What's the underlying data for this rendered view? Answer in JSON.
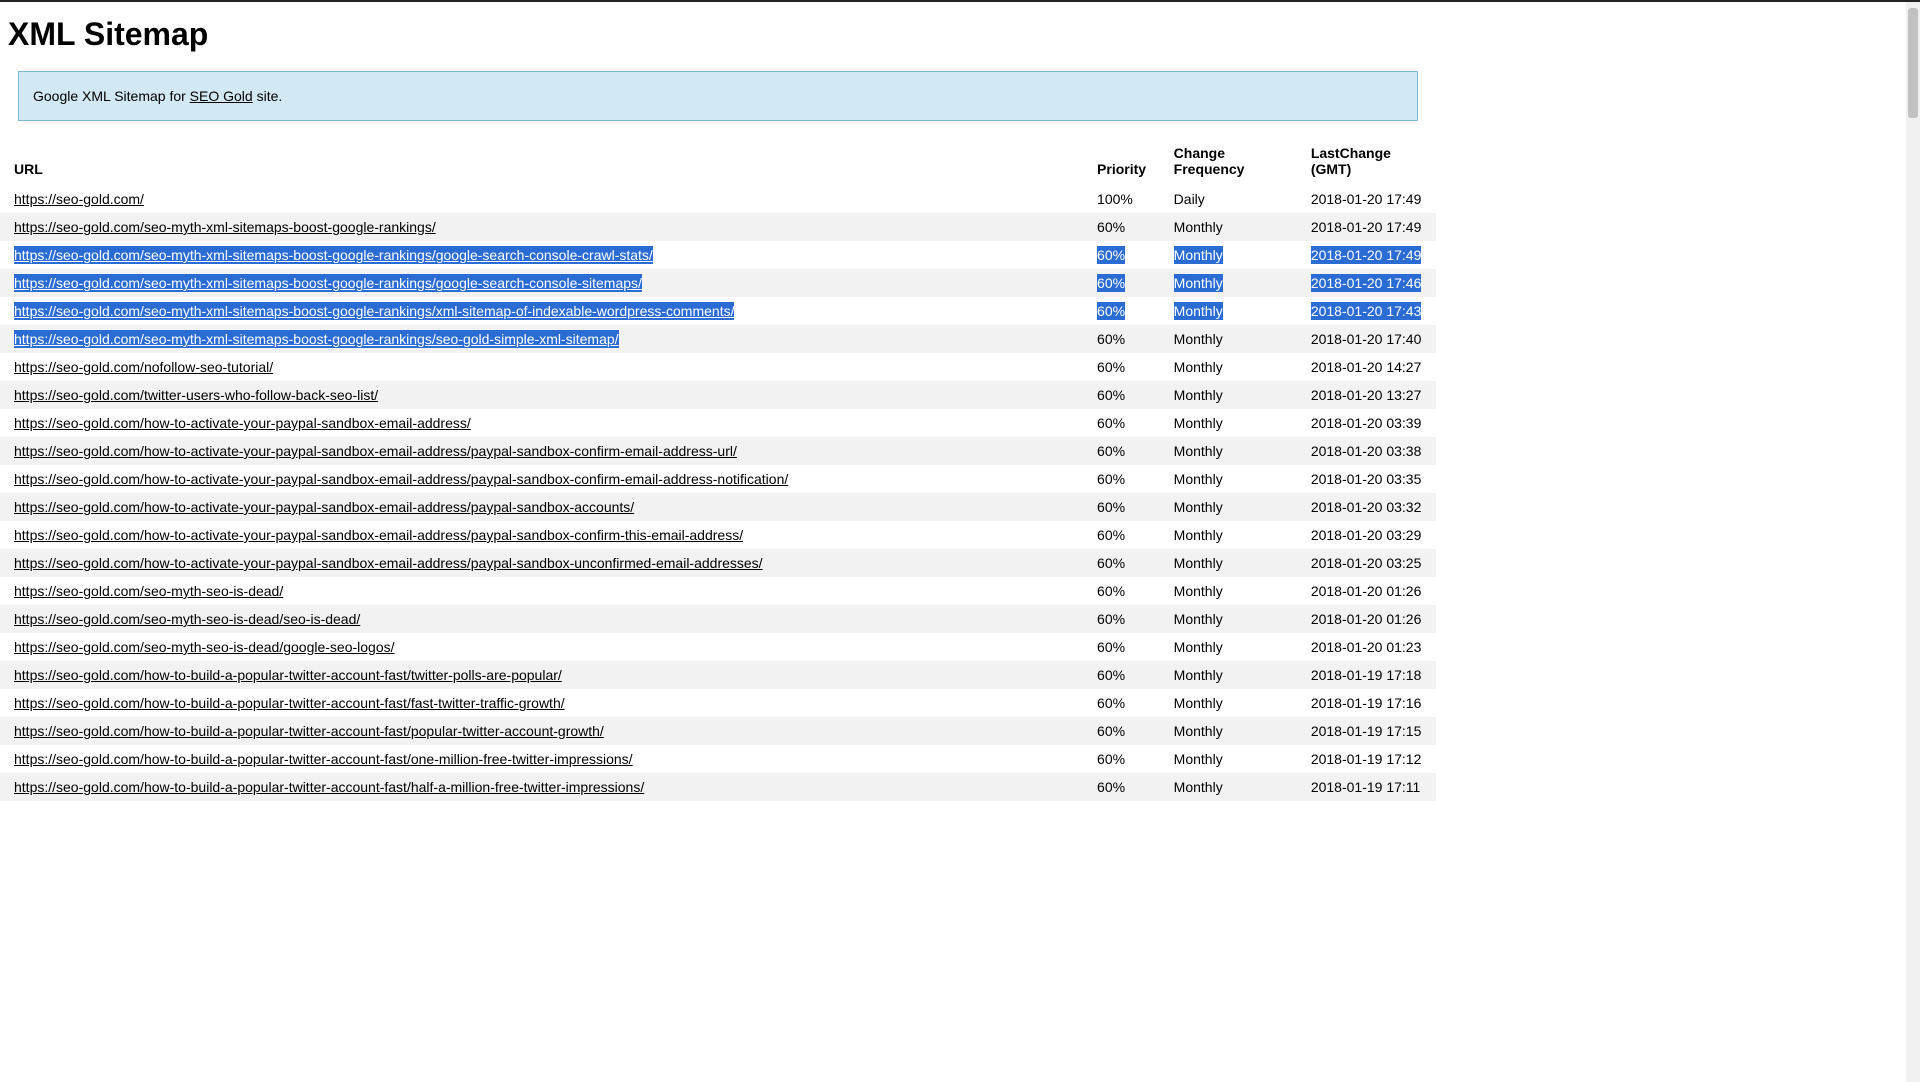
{
  "page": {
    "title": "XML Sitemap",
    "info_prefix": "Google XML Sitemap for ",
    "info_link_text": "SEO Gold",
    "info_suffix": " site."
  },
  "table": {
    "headers": {
      "url": "URL",
      "priority": "Priority",
      "changefreq_line1": "Change",
      "changefreq_line2": "Frequency",
      "lastchange_line1": "LastChange",
      "lastchange_line2": "(GMT)"
    },
    "rows": [
      {
        "url": "https://seo-gold.com/",
        "priority": "100%",
        "changefreq": "Daily",
        "lastchange": "2018-01-20 17:49",
        "selected_cols": []
      },
      {
        "url": "https://seo-gold.com/seo-myth-xml-sitemaps-boost-google-rankings/",
        "priority": "60%",
        "changefreq": "Monthly",
        "lastchange": "2018-01-20 17:49",
        "selected_cols": []
      },
      {
        "url": "https://seo-gold.com/seo-myth-xml-sitemaps-boost-google-rankings/google-search-console-crawl-stats/",
        "priority": "60%",
        "changefreq": "Monthly",
        "lastchange": "2018-01-20 17:49",
        "selected_cols": [
          "url",
          "priority",
          "changefreq",
          "lastchange"
        ]
      },
      {
        "url": "https://seo-gold.com/seo-myth-xml-sitemaps-boost-google-rankings/google-search-console-sitemaps/",
        "priority": "60%",
        "changefreq": "Monthly",
        "lastchange": "2018-01-20 17:46",
        "selected_cols": [
          "url",
          "priority",
          "changefreq",
          "lastchange"
        ]
      },
      {
        "url": "https://seo-gold.com/seo-myth-xml-sitemaps-boost-google-rankings/xml-sitemap-of-indexable-wordpress-comments/",
        "priority": "60%",
        "changefreq": "Monthly",
        "lastchange": "2018-01-20 17:43",
        "selected_cols": [
          "url",
          "priority",
          "changefreq",
          "lastchange"
        ]
      },
      {
        "url": "https://seo-gold.com/seo-myth-xml-sitemaps-boost-google-rankings/seo-gold-simple-xml-sitemap/",
        "priority": "60%",
        "changefreq": "Monthly",
        "lastchange": "2018-01-20 17:40",
        "selected_cols": [
          "url"
        ]
      },
      {
        "url": "https://seo-gold.com/nofollow-seo-tutorial/",
        "priority": "60%",
        "changefreq": "Monthly",
        "lastchange": "2018-01-20 14:27",
        "selected_cols": []
      },
      {
        "url": "https://seo-gold.com/twitter-users-who-follow-back-seo-list/",
        "priority": "60%",
        "changefreq": "Monthly",
        "lastchange": "2018-01-20 13:27",
        "selected_cols": []
      },
      {
        "url": "https://seo-gold.com/how-to-activate-your-paypal-sandbox-email-address/",
        "priority": "60%",
        "changefreq": "Monthly",
        "lastchange": "2018-01-20 03:39",
        "selected_cols": []
      },
      {
        "url": "https://seo-gold.com/how-to-activate-your-paypal-sandbox-email-address/paypal-sandbox-confirm-email-address-url/",
        "priority": "60%",
        "changefreq": "Monthly",
        "lastchange": "2018-01-20 03:38",
        "selected_cols": []
      },
      {
        "url": "https://seo-gold.com/how-to-activate-your-paypal-sandbox-email-address/paypal-sandbox-confirm-email-address-notification/",
        "priority": "60%",
        "changefreq": "Monthly",
        "lastchange": "2018-01-20 03:35",
        "selected_cols": []
      },
      {
        "url": "https://seo-gold.com/how-to-activate-your-paypal-sandbox-email-address/paypal-sandbox-accounts/",
        "priority": "60%",
        "changefreq": "Monthly",
        "lastchange": "2018-01-20 03:32",
        "selected_cols": []
      },
      {
        "url": "https://seo-gold.com/how-to-activate-your-paypal-sandbox-email-address/paypal-sandbox-confirm-this-email-address/",
        "priority": "60%",
        "changefreq": "Monthly",
        "lastchange": "2018-01-20 03:29",
        "selected_cols": []
      },
      {
        "url": "https://seo-gold.com/how-to-activate-your-paypal-sandbox-email-address/paypal-sandbox-unconfirmed-email-addresses/",
        "priority": "60%",
        "changefreq": "Monthly",
        "lastchange": "2018-01-20 03:25",
        "selected_cols": []
      },
      {
        "url": "https://seo-gold.com/seo-myth-seo-is-dead/",
        "priority": "60%",
        "changefreq": "Monthly",
        "lastchange": "2018-01-20 01:26",
        "selected_cols": []
      },
      {
        "url": "https://seo-gold.com/seo-myth-seo-is-dead/seo-is-dead/",
        "priority": "60%",
        "changefreq": "Monthly",
        "lastchange": "2018-01-20 01:26",
        "selected_cols": []
      },
      {
        "url": "https://seo-gold.com/seo-myth-seo-is-dead/google-seo-logos/",
        "priority": "60%",
        "changefreq": "Monthly",
        "lastchange": "2018-01-20 01:23",
        "selected_cols": []
      },
      {
        "url": "https://seo-gold.com/how-to-build-a-popular-twitter-account-fast/twitter-polls-are-popular/",
        "priority": "60%",
        "changefreq": "Monthly",
        "lastchange": "2018-01-19 17:18",
        "selected_cols": []
      },
      {
        "url": "https://seo-gold.com/how-to-build-a-popular-twitter-account-fast/fast-twitter-traffic-growth/",
        "priority": "60%",
        "changefreq": "Monthly",
        "lastchange": "2018-01-19 17:16",
        "selected_cols": []
      },
      {
        "url": "https://seo-gold.com/how-to-build-a-popular-twitter-account-fast/popular-twitter-account-growth/",
        "priority": "60%",
        "changefreq": "Monthly",
        "lastchange": "2018-01-19 17:15",
        "selected_cols": []
      },
      {
        "url": "https://seo-gold.com/how-to-build-a-popular-twitter-account-fast/one-million-free-twitter-impressions/",
        "priority": "60%",
        "changefreq": "Monthly",
        "lastchange": "2018-01-19 17:12",
        "selected_cols": []
      },
      {
        "url": "https://seo-gold.com/how-to-build-a-popular-twitter-account-fast/half-a-million-free-twitter-impressions/",
        "priority": "60%",
        "changefreq": "Monthly",
        "lastchange": "2018-01-19 17:11",
        "selected_cols": []
      }
    ]
  }
}
